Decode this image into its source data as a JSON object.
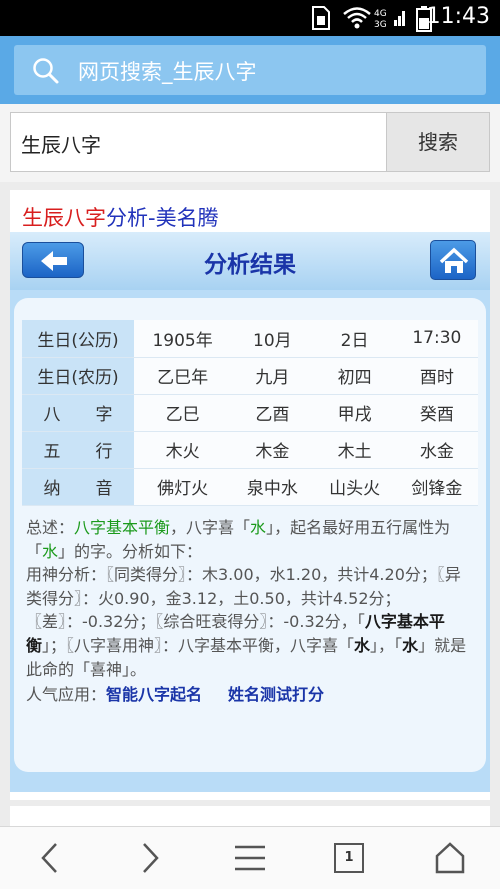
{
  "status_bar": {
    "time": "11:43",
    "network_labels": [
      "4G",
      "3G"
    ],
    "icons": [
      "sim-icon",
      "wifi-icon",
      "signal-icon",
      "battery-icon"
    ]
  },
  "browser": {
    "search_text": "网页搜索_生辰八字",
    "search_icon": "search-icon"
  },
  "search_form": {
    "input_value": "生辰八字",
    "button_label": "搜索"
  },
  "page": {
    "title_red": "生辰八字",
    "title_rest": "分析-美名腾",
    "panel_title": "分析结果",
    "back_icon": "back-arrow-icon",
    "home_icon": "home-icon"
  },
  "table": {
    "rows": [
      {
        "label": "生日(公历)",
        "values": [
          "1905年",
          "10月",
          "2日",
          "17:30"
        ]
      },
      {
        "label": "生日(农历)",
        "values": [
          "乙巳年",
          "九月",
          "初四",
          "酉时"
        ]
      },
      {
        "label_parts": [
          "八",
          "字"
        ],
        "values": [
          "乙巳",
          "乙酉",
          "甲戌",
          "癸酉"
        ]
      },
      {
        "label_parts": [
          "五",
          "行"
        ],
        "values": [
          "木火",
          "木金",
          "木土",
          "水金"
        ]
      },
      {
        "label_parts": [
          "纳",
          "音"
        ],
        "values": [
          "佛灯火",
          "泉中水",
          "山头火",
          "剑锋金"
        ]
      }
    ]
  },
  "summary": {
    "s1": "总述：",
    "s2": "八字基本平衡",
    "s3": "，八字喜「",
    "s4": "水",
    "s5": "」，起名最好用五行属性为「",
    "s6": "水",
    "s7": "」的字。分析如下：",
    "s8": "用神分析：〖同类得分〗：木3.00，水1.20，共计4.20分；〖异类得分〗：火0.90，金3.12，土0.50，共计4.52分；〖差〗：-0.32分；〖综合旺衰得分〗：-0.32分，",
    "s9": "「",
    "s10": "八字基本平衡",
    "s11": "」；〖八字喜用神〗：八字基本平衡，八字喜「",
    "s12": "水",
    "s13": "」，「",
    "s14": "水",
    "s15": "」就是此命的「喜神」。",
    "links_label": "人气应用：",
    "link1": "智能八字起名",
    "link2": "姓名测试打分"
  },
  "bottom_nav": {
    "tab_count": "1",
    "icons": [
      "back-chevron-icon",
      "forward-chevron-icon",
      "menu-icon",
      "tabs-icon",
      "home-outline-icon"
    ]
  }
}
